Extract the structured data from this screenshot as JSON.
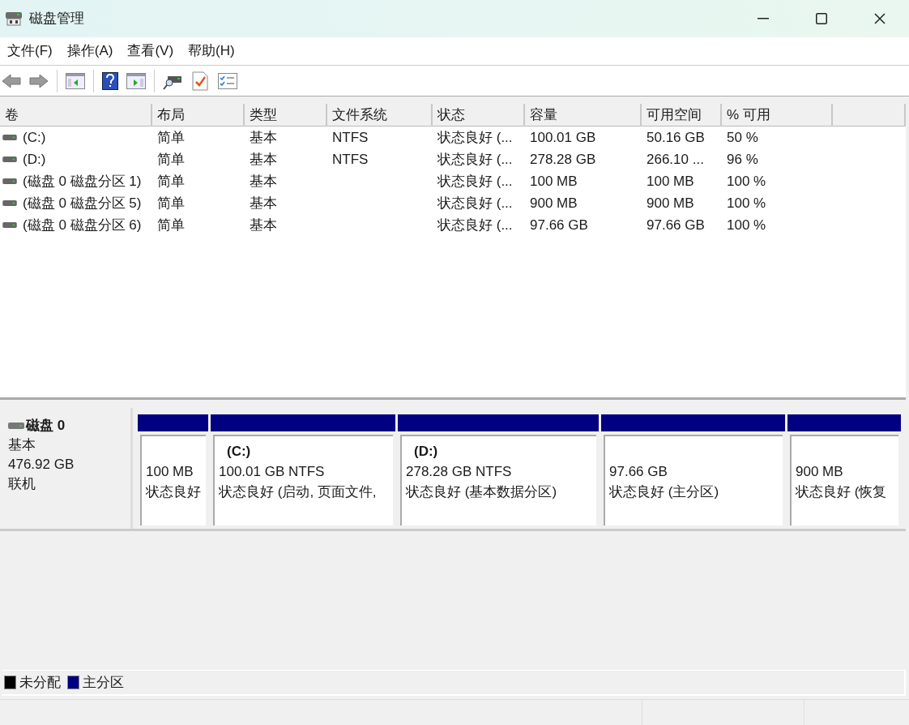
{
  "window": {
    "title": "磁盘管理"
  },
  "menu": [
    "文件(F)",
    "操作(A)",
    "查看(V)",
    "帮助(H)"
  ],
  "table": {
    "columns": [
      "卷",
      "布局",
      "类型",
      "文件系统",
      "状态",
      "容量",
      "可用空间",
      "% 可用"
    ],
    "rows": [
      [
        "(C:)",
        "简单",
        "基本",
        "NTFS",
        "状态良好 (...",
        "100.01 GB",
        "50.16 GB",
        "50 %"
      ],
      [
        "(D:)",
        "简单",
        "基本",
        "NTFS",
        "状态良好 (...",
        "278.28 GB",
        "266.10 ...",
        "96 %"
      ],
      [
        "(磁盘 0 磁盘分区 1)",
        "简单",
        "基本",
        "",
        "状态良好 (...",
        "100 MB",
        "100 MB",
        "100 %"
      ],
      [
        "(磁盘 0 磁盘分区 5)",
        "简单",
        "基本",
        "",
        "状态良好 (...",
        "900 MB",
        "900 MB",
        "100 %"
      ],
      [
        "(磁盘 0 磁盘分区 6)",
        "简单",
        "基本",
        "",
        "状态良好 (...",
        "97.66 GB",
        "97.66 GB",
        "100 %"
      ]
    ]
  },
  "disk": {
    "name": "磁盘 0",
    "type": "基本",
    "size": "476.92 GB",
    "status": "联机",
    "partitions": [
      {
        "size": "100 MB",
        "status": "状态良好"
      },
      {
        "label": "(C:)",
        "size": "100.01 GB NTFS",
        "status": "状态良好 (启动, 页面文件,"
      },
      {
        "label": "(D:)",
        "size": "278.28 GB NTFS",
        "status": "状态良好 (基本数据分区)"
      },
      {
        "size": "97.66 GB",
        "status": "状态良好 (主分区)"
      },
      {
        "size": "900 MB",
        "status": "状态良好 (恢复"
      }
    ]
  },
  "legend": [
    {
      "label": "未分配",
      "color": "#000000"
    },
    {
      "label": "主分区",
      "color": "#000080"
    }
  ]
}
